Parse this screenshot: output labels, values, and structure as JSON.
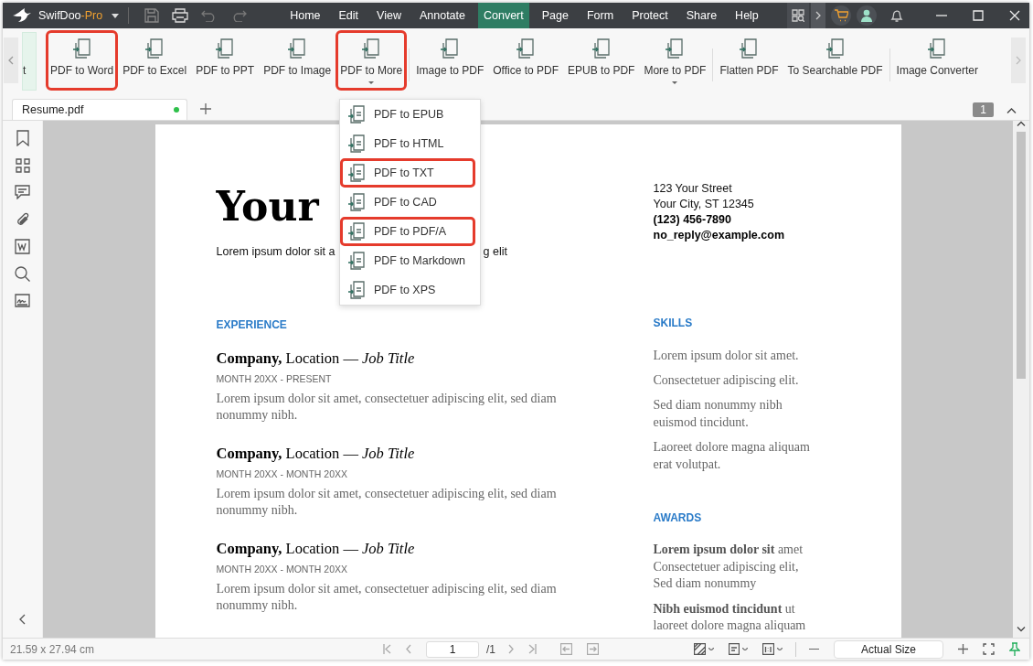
{
  "title_bar": {
    "app_name": "SwifDoo",
    "edition": "-Pro",
    "menu_tabs": [
      {
        "label": "Home",
        "selected": false
      },
      {
        "label": "Edit",
        "selected": false
      },
      {
        "label": "View",
        "selected": false
      },
      {
        "label": "Annotate",
        "selected": false
      },
      {
        "label": "Convert",
        "selected": true
      },
      {
        "label": "Page",
        "selected": false
      },
      {
        "label": "Form",
        "selected": false
      },
      {
        "label": "Protect",
        "selected": false
      },
      {
        "label": "Share",
        "selected": false
      },
      {
        "label": "Help",
        "selected": false
      }
    ]
  },
  "ribbon": {
    "partial_item": {
      "label": "t"
    },
    "groups": [
      {
        "items": [
          {
            "label": "PDF to Word",
            "dropdown": false,
            "highlighted": true
          },
          {
            "label": "PDF to Excel",
            "dropdown": false,
            "highlighted": false
          },
          {
            "label": "PDF to PPT",
            "dropdown": false,
            "highlighted": false
          },
          {
            "label": "PDF to Image",
            "dropdown": false,
            "highlighted": false
          },
          {
            "label": "PDF to More",
            "dropdown": true,
            "highlighted": true
          }
        ]
      },
      {
        "items": [
          {
            "label": "Image to PDF",
            "dropdown": false,
            "highlighted": false
          },
          {
            "label": "Office to PDF",
            "dropdown": false,
            "highlighted": false
          },
          {
            "label": "EPUB to PDF",
            "dropdown": false,
            "highlighted": false
          },
          {
            "label": "More to PDF",
            "dropdown": true,
            "highlighted": false
          }
        ]
      },
      {
        "items": [
          {
            "label": "Flatten PDF",
            "dropdown": false,
            "highlighted": false
          },
          {
            "label": "To Searchable PDF",
            "dropdown": false,
            "highlighted": false
          }
        ]
      },
      {
        "items": [
          {
            "label": "Image Converter",
            "dropdown": false,
            "highlighted": false
          }
        ]
      }
    ]
  },
  "document_tabs": [
    {
      "label": "Resume.pdf",
      "selected": true,
      "modified": true
    }
  ],
  "page_badge": "1",
  "dropdown": {
    "items": [
      {
        "label": "PDF to EPUB",
        "highlighted": false
      },
      {
        "label": "PDF to HTML",
        "highlighted": false
      },
      {
        "label": "PDF to TXT",
        "highlighted": true
      },
      {
        "label": "PDF to CAD",
        "highlighted": false
      },
      {
        "label": "PDF to PDF/A",
        "highlighted": true
      },
      {
        "label": "PDF to Markdown",
        "highlighted": false
      },
      {
        "label": "PDF to XPS",
        "highlighted": false
      }
    ]
  },
  "document": {
    "name_visible": "Your",
    "lead_left": "Lorem ipsum dolor sit a",
    "lead_right": "g elit",
    "address": [
      "123 Your Street",
      "Your City, ST 12345"
    ],
    "phone": "(123) 456-7890",
    "email": "no_reply@example.com",
    "experience_heading": "EXPERIENCE",
    "jobs": [
      {
        "company": "Company,",
        "location": " Location — ",
        "title": "Job Title",
        "dates": "MONTH 20XX - PRESENT",
        "description": "Lorem ipsum dolor sit amet, consectetuer adipiscing elit, sed diam\nnonummy nibh."
      },
      {
        "company": "Company,",
        "location": " Location — ",
        "title": "Job Title",
        "dates": "MONTH 20XX - MONTH 20XX",
        "description": "Lorem ipsum dolor sit amet, consectetuer adipiscing elit, sed diam\nnonummy nibh."
      },
      {
        "company": "Company,",
        "location": " Location — ",
        "title": "Job Title",
        "dates": "MONTH 20XX - MONTH 20XX",
        "description": "Lorem ipsum dolor sit amet, consectetuer adipiscing elit, sed diam\nnonummy nibh."
      }
    ],
    "skills_heading": "SKILLS",
    "skills": [
      "Lorem ipsum dolor sit amet.",
      "Consectetuer adipiscing elit.",
      "Sed diam nonummy nibh\neuismod tincidunt.",
      "Laoreet dolore magna aliquam\nerat volutpat."
    ],
    "awards_heading": "AWARDS",
    "awards": [
      "**Lorem ipsum dolor sit** amet\nConsectetuer adipiscing elit,\nSed diam nonummy",
      "**Nibh euismod tincidunt** ut\nlaoreet dolore magna aliquam"
    ]
  },
  "status_bar": {
    "page_size": "21.59 x 27.94 cm",
    "page_input": "1",
    "page_total": "/1",
    "zoom": "Actual Size"
  }
}
